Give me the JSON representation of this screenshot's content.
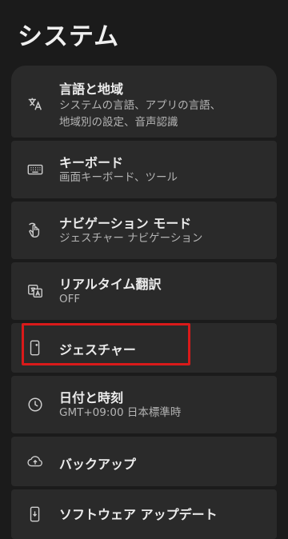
{
  "page": {
    "title": "システム"
  },
  "items": [
    {
      "title": "言語と地域",
      "subtitle_line1": "システムの言語、アプリの言語、",
      "subtitle_line2": "地域別の設定、音声認識",
      "icon": "translate-icon"
    },
    {
      "title": "キーボード",
      "subtitle": "画面キーボード、ツール",
      "icon": "keyboard-icon"
    },
    {
      "title": "ナビゲーション モード",
      "subtitle": "ジェスチャー ナビゲーション",
      "icon": "gesture-hand-icon"
    },
    {
      "title": "リアルタイム翻訳",
      "subtitle": "OFF",
      "icon": "live-translate-icon"
    },
    {
      "title": "ジェスチャー",
      "icon": "phone-gesture-icon"
    },
    {
      "title": "日付と時刻",
      "subtitle": "GMT+09:00 日本標準時",
      "icon": "clock-icon"
    },
    {
      "title": "バックアップ",
      "icon": "cloud-upload-icon"
    },
    {
      "title": "ソフトウェア アップデート",
      "icon": "system-update-icon"
    }
  ],
  "colors": {
    "background": "#1b1b1b",
    "card": "#2a2a2a",
    "highlight": "#d91a1a"
  }
}
